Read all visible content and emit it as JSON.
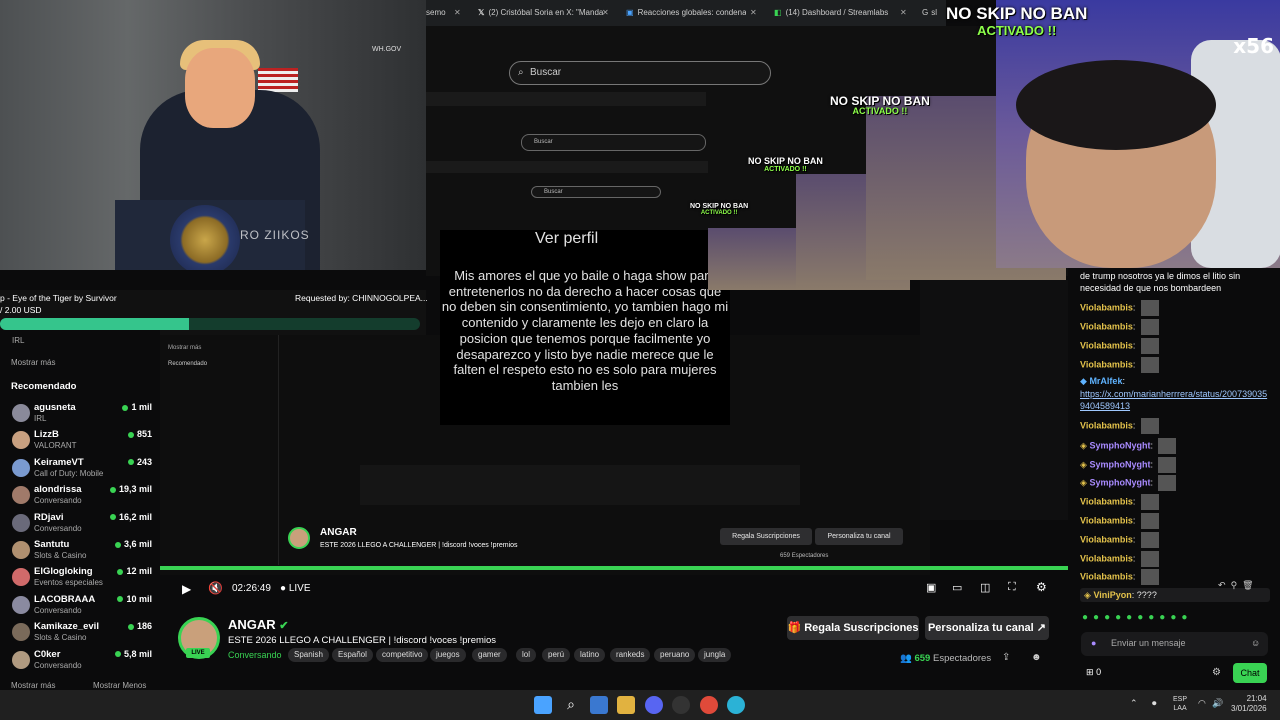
{
  "top_video": {
    "watermark": "RO ZIIKOS",
    "seal_text": "WH.GOV"
  },
  "song": {
    "title": "p - Eye of the Tiger by Survivor",
    "requested_by": "Requested by: CHINNOGOLPEA...",
    "price": "/ 2.00 USD",
    "progress": 0.45
  },
  "tabs": [
    {
      "label": "semo"
    },
    {
      "label": "(2) Cristóbal Soria en X: \"Manda"
    },
    {
      "label": "Reacciones globales: condena"
    },
    {
      "label": "(14) Dashboard / Streamlabs"
    },
    {
      "label": "sl"
    }
  ],
  "search": {
    "placeholder": "Buscar",
    "mini": "Buscar"
  },
  "overlay": {
    "title": "Ver perfil",
    "body": "Mis amores el que yo baile o haga show para entretenerlos no da derecho a hacer cosas que no deben sin consentimiento, yo tambien hago mi contenido y claramente les dejo en claro la posicion que tenemos porque facilmente yo desaparezco y listo bye nadie merece que le falten el respeto esto no es solo para mujeres tambien les"
  },
  "nsnb": {
    "main": "NO SKIP NO BAN",
    "sub": "ACTIVADO !!"
  },
  "cam": {
    "multiplier": "x56"
  },
  "chat": {
    "lines": [
      {
        "user": "",
        "text": "de trump nosotros ya le dimos el litio sin"
      },
      {
        "user": "",
        "text": "necesidad de que nos bombardeen"
      },
      {
        "user": "Violabambis",
        "text": ""
      },
      {
        "user": "Violabambis",
        "text": ""
      },
      {
        "user": "Violabambis",
        "text": ""
      },
      {
        "user": "Violabambis",
        "text": ""
      },
      {
        "user": "MrAlfek",
        "text": ""
      },
      {
        "user": "",
        "text": "https://x.com/marianherrrera/status/200739035"
      },
      {
        "user": "",
        "text": "9404589413"
      },
      {
        "user": "Violabambis",
        "text": ""
      },
      {
        "user": "SymphoNyght",
        "text": ""
      },
      {
        "user": "SymphoNyght",
        "text": ""
      },
      {
        "user": "SymphoNyght",
        "text": ""
      },
      {
        "user": "Violabambis",
        "text": ""
      },
      {
        "user": "Violabambis",
        "text": ""
      },
      {
        "user": "Violabambis",
        "text": ""
      },
      {
        "user": "Violabambis",
        "text": ""
      },
      {
        "user": "Violabambis",
        "text": ""
      },
      {
        "user": "ViniPyon",
        "text": "????"
      }
    ],
    "input_placeholder": "Enviar un mensaje",
    "points": "0",
    "send_label": "Chat"
  },
  "sidebar": {
    "show_more_top": "Mostrar más",
    "recommended_heading": "Recomendado",
    "top_cat": "IRL",
    "items": [
      {
        "name": "agusneta",
        "category": "IRL",
        "viewers": "1 mil"
      },
      {
        "name": "LizzB",
        "category": "VALORANT",
        "viewers": "851"
      },
      {
        "name": "KeirameVT",
        "category": "Call of Duty: Mobile",
        "viewers": "243"
      },
      {
        "name": "alondrissa",
        "category": "Conversando",
        "viewers": "19,3 mil"
      },
      {
        "name": "RDjavi",
        "category": "Conversando",
        "viewers": "16,2 mil"
      },
      {
        "name": "Santutu",
        "category": "Slots & Casino",
        "viewers": "3,6 mil"
      },
      {
        "name": "ElGlogloking",
        "category": "Eventos especiales",
        "viewers": "12 mil"
      },
      {
        "name": "LACOBRAAA",
        "category": "Conversando",
        "viewers": "10 mil"
      },
      {
        "name": "Kamikaze_evil",
        "category": "Slots & Casino",
        "viewers": "186"
      },
      {
        "name": "C0ker",
        "category": "Conversando",
        "viewers": "5,8 mil"
      }
    ],
    "show_more": "Mostrar más",
    "show_less": "Mostrar Menos"
  },
  "player": {
    "time": "02:26:49",
    "live": "LIVE"
  },
  "stream": {
    "channel": "ANGAR",
    "title": "ESTE 2026 LLEGO A CHALLENGER | !discord !voces !premios",
    "category": "Conversando",
    "tags": [
      "Spanish",
      "Español",
      "competitivo",
      "juegos",
      "gamer",
      "lol",
      "perú",
      "latino",
      "rankeds",
      "peruano",
      "jungla"
    ],
    "live_badge": "LIVE",
    "subs_button": "Regala Suscripciones",
    "custom_button": "Personaliza tu canal",
    "viewers_count": "659",
    "viewers_label": "Espectadores"
  },
  "taskbar": {
    "lang": "ESP",
    "lang2": "LAA",
    "time": "21:04",
    "date": "3/01/2026"
  },
  "colors": {
    "accent": "#39d353",
    "username_gold": "#e3c24b"
  }
}
